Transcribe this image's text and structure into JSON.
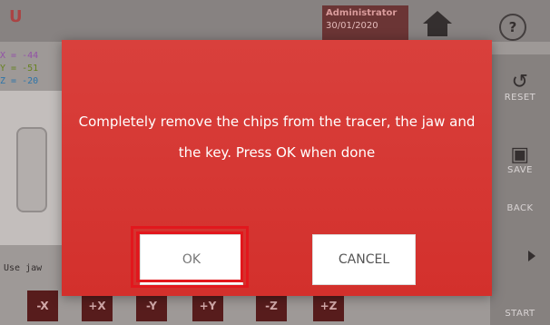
{
  "header": {
    "logo": "U",
    "user": "Administrator",
    "date": "30/01/2020",
    "help_label": "?"
  },
  "coords": {
    "x": "X = -44",
    "y": "Y = -51",
    "z": "Z = -20"
  },
  "status_text": "Use jaw",
  "right_panel": {
    "reset_label": "RESET",
    "save_label": "SAVE",
    "back_label": "BACK",
    "start_label": "START"
  },
  "axis_buttons": [
    "-X",
    "+X",
    "-Y",
    "+Y",
    "-Z",
    "+Z"
  ],
  "dialog": {
    "message": "Completely remove the chips from the tracer, the jaw and the key. Press OK when done",
    "ok_label": "OK",
    "cancel_label": "CANCEL",
    "background_color": "#d3302c",
    "highlight_color": "#e2171d"
  }
}
